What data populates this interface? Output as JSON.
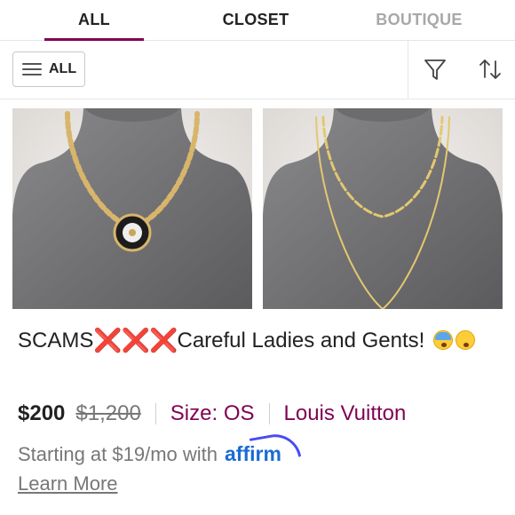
{
  "tabs": [
    {
      "label": "ALL",
      "active": true
    },
    {
      "label": "CLOSET",
      "active": false
    },
    {
      "label": "BOUTIQUE",
      "active": false
    }
  ],
  "filter": {
    "category_label": "ALL",
    "icons": [
      "menu-icon",
      "filter-icon",
      "sort-icon"
    ]
  },
  "listing": {
    "title_text_1": "SCAMS",
    "title_marks": [
      "❌",
      "❌",
      "❌"
    ],
    "title_text_2": "Careful Ladies and Gents!",
    "title_emojis": [
      "😨",
      "😳"
    ],
    "price": "$200",
    "original_price": "$1,200",
    "size": "Size: OS",
    "brand": "Louis Vuitton",
    "financing": "Starting at $19/mo with",
    "financing_provider": "affirm",
    "learn_more": "Learn More"
  },
  "colors": {
    "accent": "#7f0353",
    "affirm": "#1b6bd3"
  }
}
